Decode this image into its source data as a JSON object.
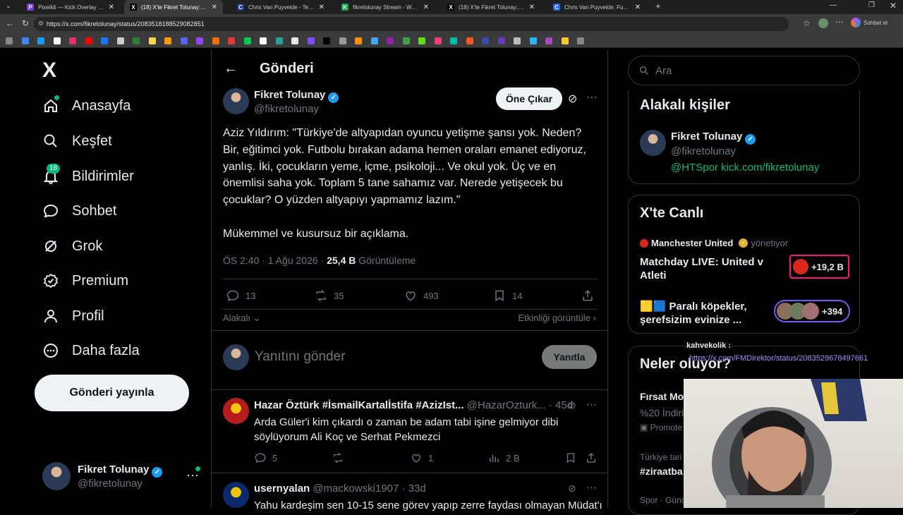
{
  "browser": {
    "tabs": [
      {
        "title": "Pixelkit — Kick Overlay & Bot",
        "fav_color": "#7c3aed",
        "fav_glyph": "P",
        "active": false
      },
      {
        "title": "(18) X'te Fikret Tolunay: \"Aziz Yıldırı",
        "fav_color": "#000000",
        "fav_glyph": "X",
        "active": true
      },
      {
        "title": "Chris Van Puyvelde - Teknik Direktö",
        "fav_color": "#1e3a8a",
        "fav_glyph": "C",
        "active": false
      },
      {
        "title": "fikretolunay Stream - Watch Live o",
        "fav_color": "#16a34a",
        "fav_glyph": "K",
        "active": false
      },
      {
        "title": "(18) X'te Fikret Tolunay: \"Fenerbahç",
        "fav_color": "#000000",
        "fav_glyph": "X",
        "active": false
      },
      {
        "title": "Chris Van Puyvelde: Futbol Profes",
        "fav_color": "#2563eb",
        "fav_glyph": "C",
        "active": false
      }
    ],
    "url": "https://x.com/fikretolunay/status/2083518188529082851",
    "profile_label": "Sohbet et"
  },
  "nav": {
    "logo": "X",
    "items": [
      {
        "name": "home",
        "label": "Anasayfa",
        "icon": "home-icon"
      },
      {
        "name": "explore",
        "label": "Keşfet",
        "icon": "search-icon"
      },
      {
        "name": "notifications",
        "label": "Bildirimler",
        "icon": "bell-icon",
        "badge": "18"
      },
      {
        "name": "chat",
        "label": "Sohbet",
        "icon": "chat-icon"
      },
      {
        "name": "grok",
        "label": "Grok",
        "icon": "grok-icon"
      },
      {
        "name": "premium",
        "label": "Premium",
        "icon": "premium-icon"
      },
      {
        "name": "profile",
        "label": "Profil",
        "icon": "person-icon"
      },
      {
        "name": "more",
        "label": "Daha fazla",
        "icon": "more-circle-icon"
      }
    ],
    "post_button": "Gönderi yayınla",
    "account": {
      "name": "Fikret Tolunay",
      "handle": "@fikretolunay"
    }
  },
  "header": {
    "title": "Gönderi"
  },
  "post": {
    "author": "Fikret Tolunay",
    "handle": "@fikretolunay",
    "highlight_button": "Öne Çıkar",
    "text_lines": [
      "Aziz Yıldırım: \"Türkiye'de altyapıdan oyuncu yetişme şansı yok. Neden?",
      "Bir, eğitimci yok. Futbolu bırakan adama hemen oraları emanet ediyoruz,",
      "yanlış. İki, çocukların yeme, içme, psikoloji... Ve okul yok. Üç ve en",
      "önemlisi saha yok. Toplam 5 tane sahamız var. Nerede yetişecek bu",
      "çocuklar? O yüzden altyapıyı yapmamız lazım.\"",
      "",
      "Mükemmel ve kusursuz bir açıklama."
    ],
    "time": "ÖS 2:40 · 1 Ağu 2026 · ",
    "views": "25,4 B",
    "views_label": " Görüntüleme",
    "replies": "13",
    "reposts": "35",
    "likes": "493",
    "bookmarks": "14",
    "relevance": "Alakalı",
    "activity_link": "Etkinliği görüntüle"
  },
  "reply_box": {
    "placeholder": "Yanıtını gönder",
    "button": "Yanıtla"
  },
  "replies": [
    {
      "author": "Hazar Öztürk #İsmailKartalİstifa #AzizIst...",
      "handle": "@HazarOzturk...",
      "time": "· 45d",
      "text_lines": [
        "Arda Güler'i kim çıkardı o zaman be adam tabi işine gelmiyor dibi",
        "söylüyorum Ali Koç ve Serhat Pekmezci"
      ],
      "replies": "5",
      "reposts": "",
      "likes": "1",
      "views": "2 B"
    },
    {
      "author": "usernyalan",
      "handle": "@mackowski1907",
      "time": "· 33d",
      "text_lines": [
        "Yahu kardeşim sen 10-15 sene görev yapıp zerre faydası olmayan Müdat'ı"
      ],
      "replies": "",
      "reposts": "",
      "likes": "",
      "views": ""
    }
  ],
  "sidebar": {
    "search_placeholder": "Ara",
    "related_title": "Alakalı kişiler",
    "related_person": {
      "name": "Fikret Tolunay",
      "handle": "@fikretolunay",
      "bio": "@HTSpor kick.com/fikretolunay"
    },
    "live_title": "X'te Canlı",
    "live_host": "Manchester United",
    "live_host_suffix": "yönetiyor",
    "live1_title": "Matchday LIVE: United v Atleti",
    "live1_count": "+19,2 B",
    "live2_title": "🟨🟦 Paralı köpekler, şerefsizim evinize ...",
    "live2_count": "+394",
    "trends_title": "Neler oluyor?",
    "trend1_name": "Fırsat Mo",
    "trend1_sub": "%20 İndiri",
    "trend1_promoted": "Promote",
    "trend2_meta": "Türkiye tari",
    "trend2_tag": "#ziraatba",
    "trend3_meta": "Spor · Günd"
  },
  "overlay": {
    "chat_user": "kahvekolik :",
    "chat_text": "https://x.com/FMDirektor/status/2083529678497661"
  }
}
